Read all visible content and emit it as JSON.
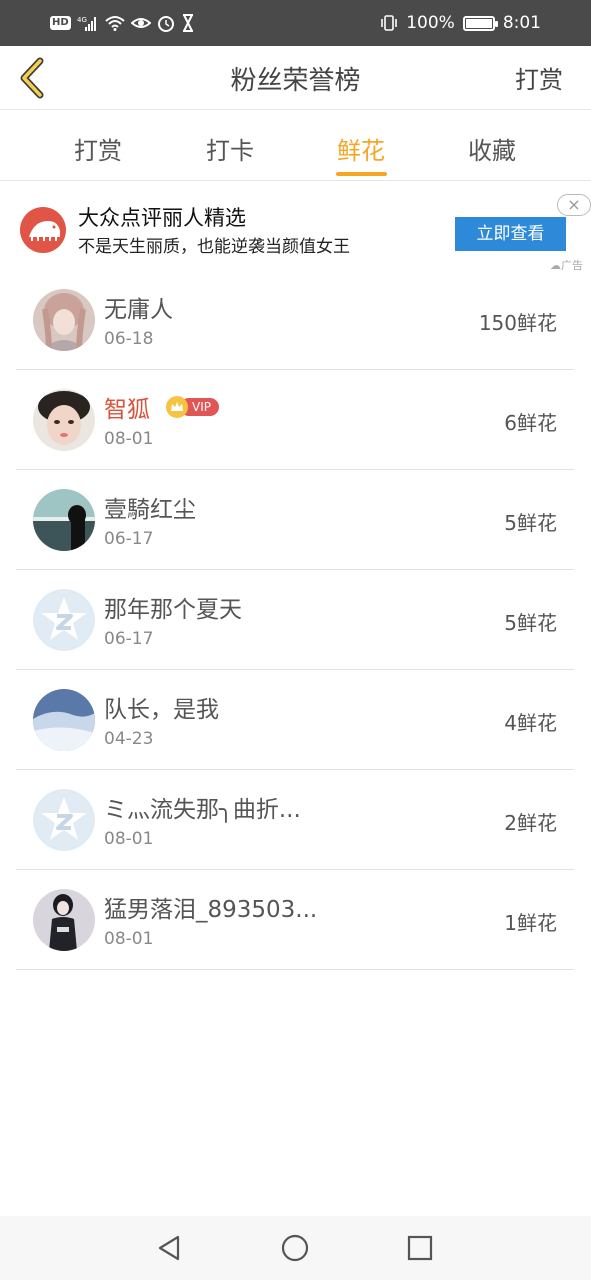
{
  "status_bar": {
    "hd": "HD",
    "net": "4G",
    "battery": "100%",
    "time": "8:01"
  },
  "header": {
    "title": "粉丝荣誉榜",
    "action": "打赏"
  },
  "tabs": [
    {
      "label": "打赏"
    },
    {
      "label": "打卡"
    },
    {
      "label": "鲜花"
    },
    {
      "label": "收藏"
    }
  ],
  "active_tab": "鲜花",
  "ad": {
    "title": "大众点评丽人精选",
    "description": "不是天生丽质，也能逆袭当颜值女王",
    "button": "立即查看",
    "close": "×",
    "tag": "广告"
  },
  "list": [
    {
      "name": "无庸人",
      "date": "06-18",
      "count": "150鲜花",
      "avatar": "photo-pink"
    },
    {
      "name": "智狐",
      "date": "08-01",
      "count": "6鲜花",
      "avatar": "photo-face",
      "vip": "VIP"
    },
    {
      "name": "壹騎红尘",
      "date": "06-17",
      "count": "5鲜花",
      "avatar": "photo-dusk"
    },
    {
      "name": "那年那个夏天",
      "date": "06-17",
      "count": "5鲜花",
      "avatar": "default-qzone"
    },
    {
      "name": "队长，是我",
      "date": "04-23",
      "count": "4鲜花",
      "avatar": "photo-snow"
    },
    {
      "name": "ミ灬流失那╮曲折...",
      "date": "08-01",
      "count": "2鲜花",
      "avatar": "default-qzone"
    },
    {
      "name": "猛男落泪_893503...",
      "date": "08-01",
      "count": "1鲜花",
      "avatar": "photo-dark"
    }
  ],
  "colors": {
    "accent": "#f5a623",
    "vip_name": "#d9533c",
    "ad_button": "#2e8ad8",
    "status_bar": "#4a4a4a"
  }
}
